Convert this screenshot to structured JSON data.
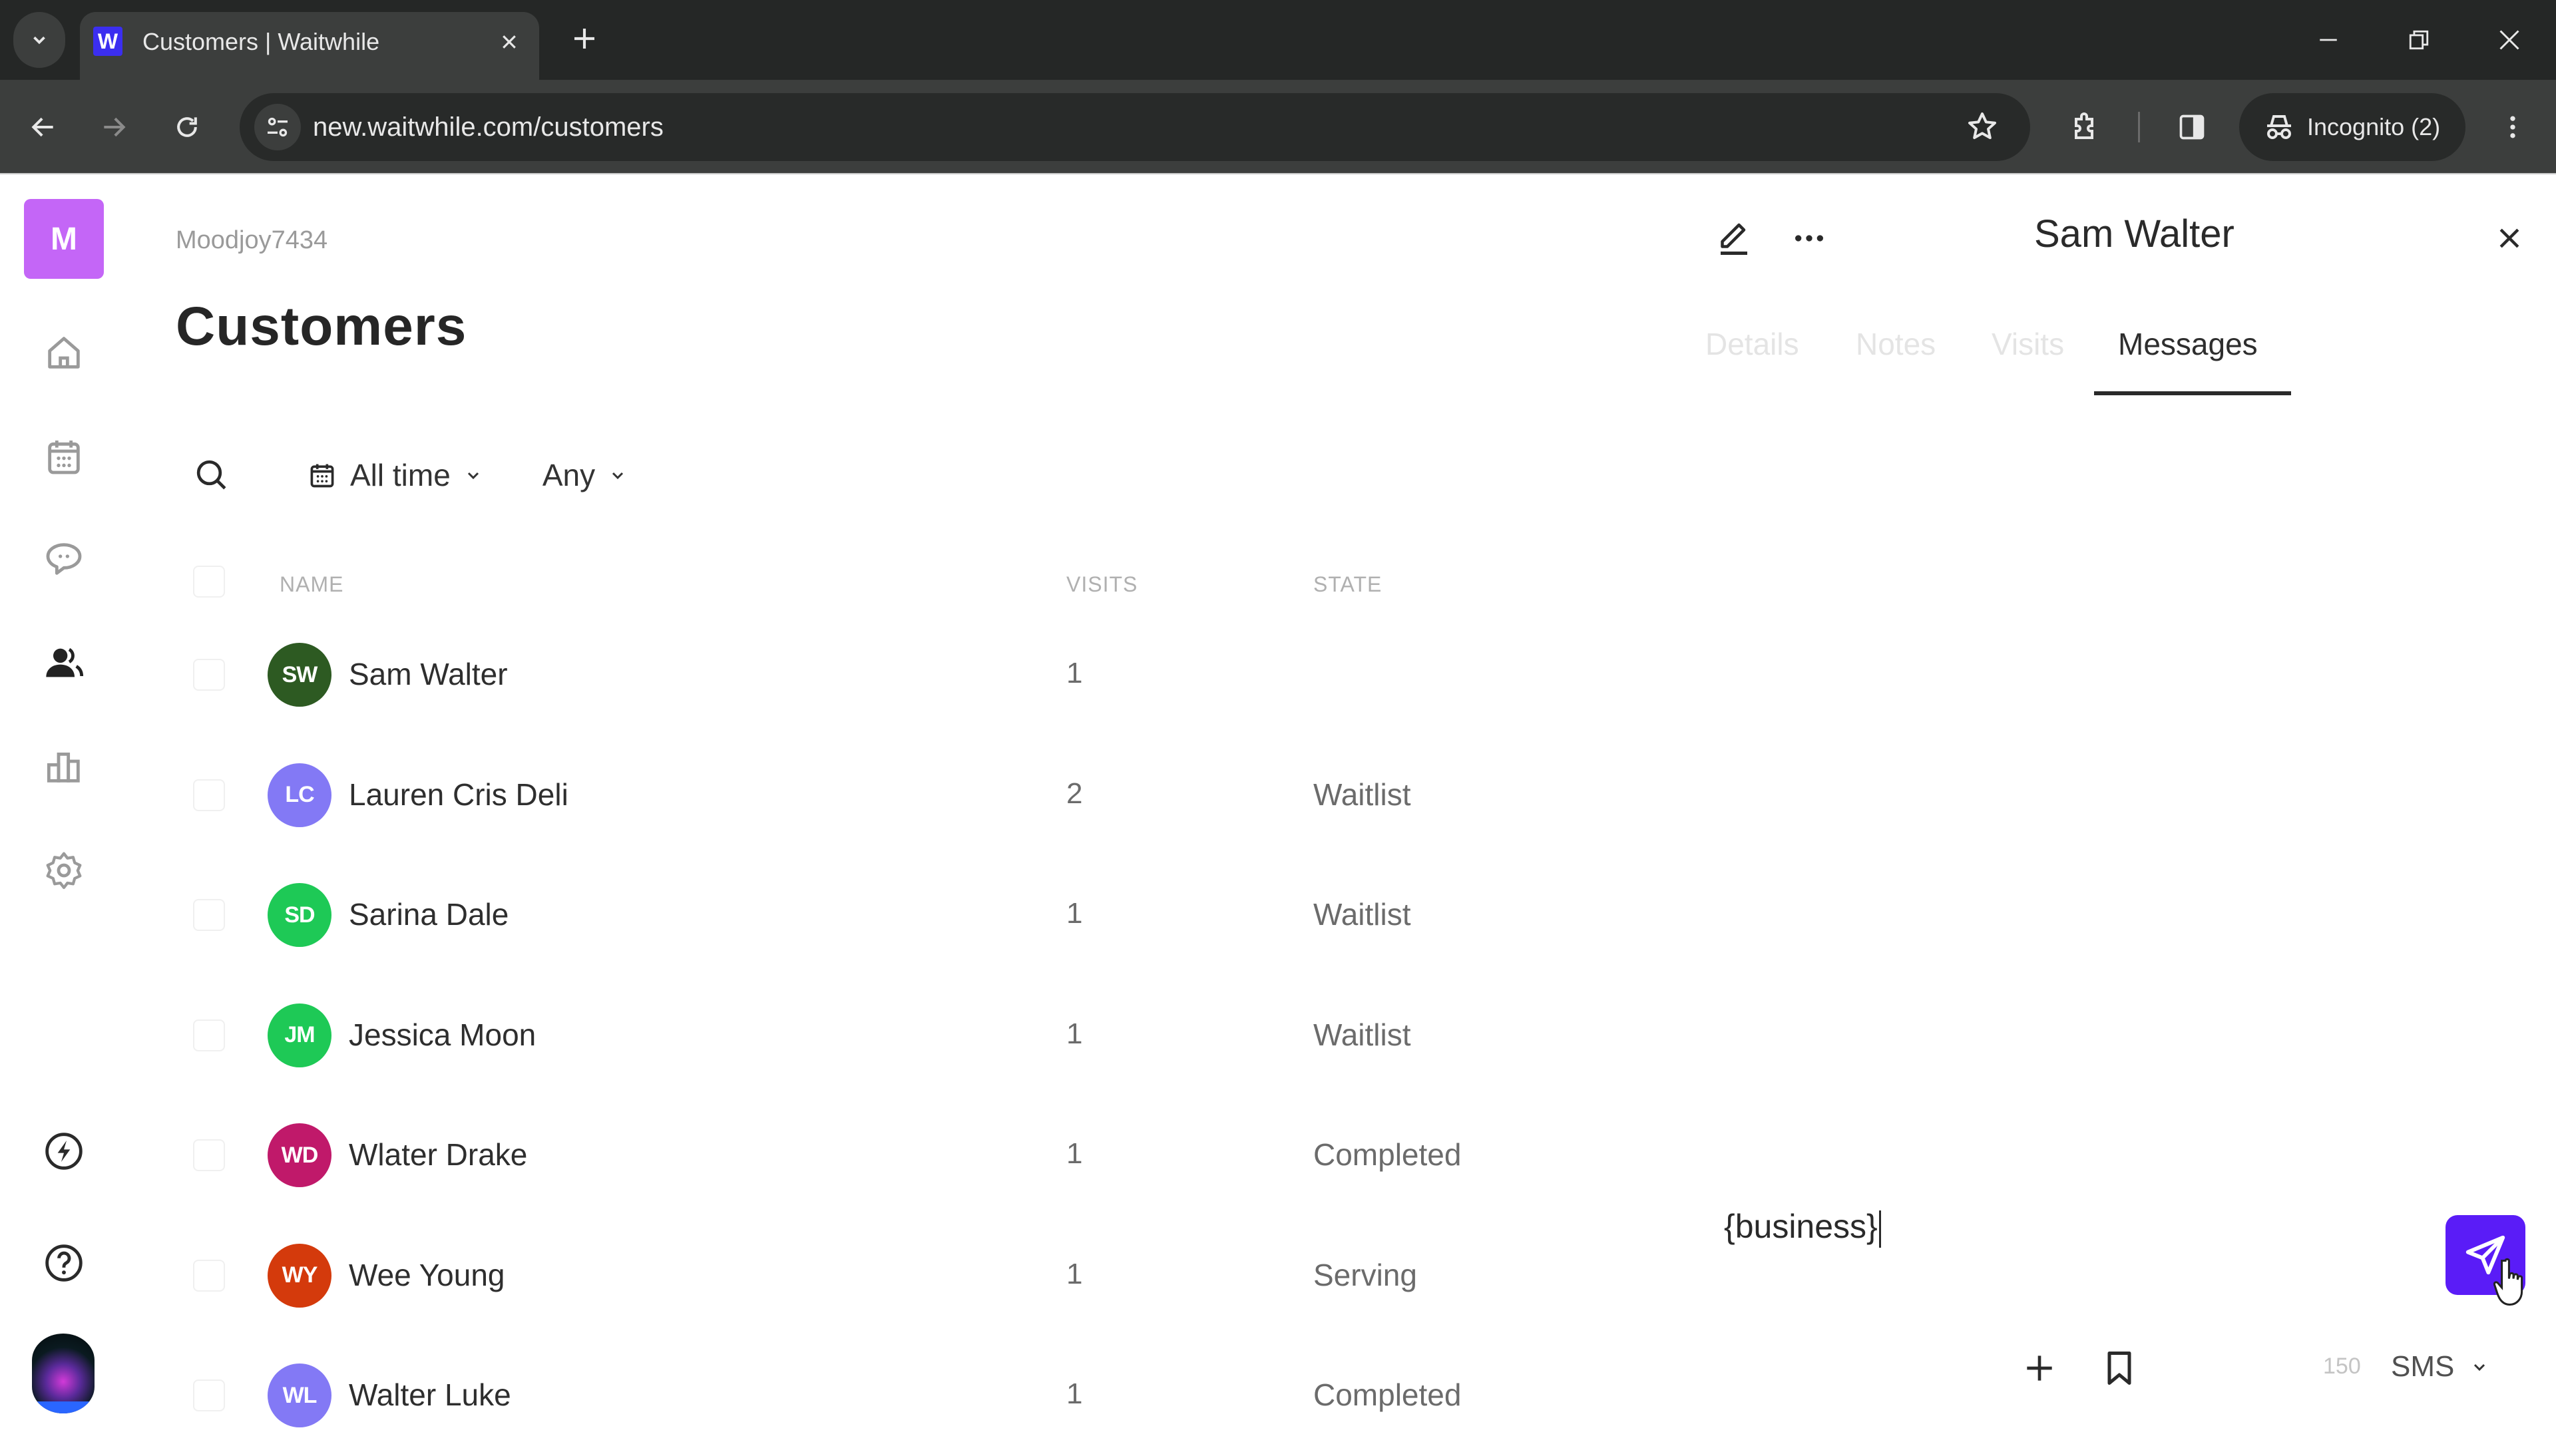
{
  "browser": {
    "tab_title": "Customers | Waitwhile",
    "favicon_letter": "W",
    "url": "new.waitwhile.com/customers",
    "incognito_label": "Incognito (2)"
  },
  "sidebar": {
    "org_initial": "M",
    "items": [
      {
        "id": "home",
        "icon": "home-icon"
      },
      {
        "id": "calendar",
        "icon": "calendar-icon"
      },
      {
        "id": "messages",
        "icon": "chat-icon"
      },
      {
        "id": "customers",
        "icon": "users-icon",
        "active": true
      },
      {
        "id": "analytics",
        "icon": "bar-chart-icon"
      },
      {
        "id": "settings",
        "icon": "gear-icon"
      },
      {
        "id": "whats-new",
        "icon": "lightning-icon"
      },
      {
        "id": "help",
        "icon": "help-icon"
      }
    ]
  },
  "main": {
    "org_name": "Moodjoy7434",
    "title": "Customers",
    "filters": {
      "date_range": "All time",
      "state": "Any"
    },
    "table": {
      "columns": [
        "NAME",
        "VISITS",
        "STATE"
      ],
      "rows": [
        {
          "initials": "SW",
          "name": "Sam Walter",
          "visits": "1",
          "state": "",
          "color": "#2d5a22"
        },
        {
          "initials": "LC",
          "name": "Lauren Cris Deli",
          "visits": "2",
          "state": "Waitlist",
          "color": "#8379f5"
        },
        {
          "initials": "SD",
          "name": "Sarina Dale",
          "visits": "1",
          "state": "Waitlist",
          "color": "#1ec956"
        },
        {
          "initials": "JM",
          "name": "Jessica Moon",
          "visits": "1",
          "state": "Waitlist",
          "color": "#1ec956"
        },
        {
          "initials": "WD",
          "name": "Wlater Drake",
          "visits": "1",
          "state": "Completed",
          "color": "#c0196a"
        },
        {
          "initials": "WY",
          "name": "Wee Young",
          "visits": "1",
          "state": "Serving",
          "color": "#d43a0c"
        },
        {
          "initials": "WL",
          "name": "Walter Luke",
          "visits": "1",
          "state": "Completed",
          "color": "#8379f5"
        }
      ]
    }
  },
  "panel": {
    "customer_name": "Sam Walter",
    "tabs": [
      "Details",
      "Notes",
      "Visits",
      "Messages"
    ],
    "active_tab": "Messages",
    "composer_text": "{business}",
    "char_count": "150",
    "channel": "SMS",
    "accent": "#5a1cf7"
  }
}
